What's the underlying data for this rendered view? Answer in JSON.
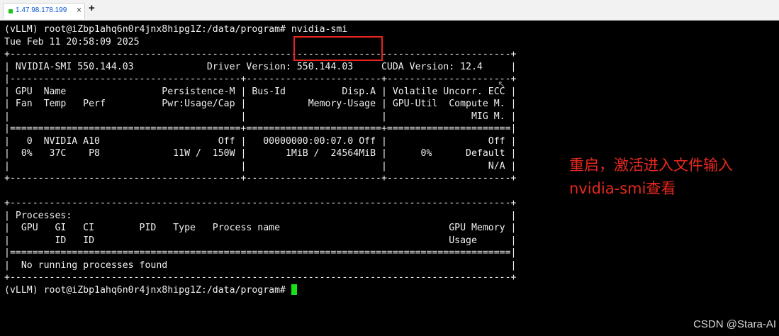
{
  "tab": {
    "title": "1.47.98.178.199",
    "close": "×",
    "new": "+"
  },
  "terminal": {
    "lines": [
      "(vLLM) root@iZbp1ahq6n0r4jnx8hipg1Z:/data/program# nvidia-smi",
      "Tue Feb 11 20:58:09 2025",
      "+-----------------------------------------------------------------------------------------+",
      "| NVIDIA-SMI 550.144.03             Driver Version: 550.144.03     CUDA Version: 12.4     |",
      "|-----------------------------------------+------------------------+----------------------+",
      "| GPU  Name                 Persistence-M | Bus-Id          Disp.A | Volatile Uncorr. ECC |",
      "| Fan  Temp   Perf          Pwr:Usage/Cap |           Memory-Usage | GPU-Util  Compute M. |",
      "|                                         |                        |               MIG M. |",
      "|=========================================+========================+======================|",
      "|   0  NVIDIA A10                     Off |   00000000:00:07.0 Off |                  Off |",
      "|  0%   37C    P8             11W /  150W |       1MiB /  24564MiB |      0%      Default |",
      "|                                         |                        |                  N/A |",
      "+-----------------------------------------+------------------------+----------------------+",
      "",
      "+-----------------------------------------------------------------------------------------+",
      "| Processes:                                                                              |",
      "|  GPU   GI   CI        PID   Type   Process name                              GPU Memory |",
      "|        ID   ID                                                               Usage      |",
      "|=========================================================================================|",
      "|  No running processes found                                                             |",
      "+-----------------------------------------------------------------------------------------+"
    ],
    "prompt": "(vLLM) root@iZbp1ahq6n0r4jnx8hipg1Z:/data/program# "
  },
  "annotation": {
    "line1": "重启，激活进入文件输入",
    "line2": "nvidia-smi查看"
  },
  "watermark": "CSDN @Stara-AI",
  "icons": {
    "tab_status": "status-dot-icon",
    "mouse": "mouse-pointer-icon"
  },
  "colors": {
    "accent": "#e8231e",
    "cursor": "#16e216",
    "tab_title": "#0b57d0"
  }
}
